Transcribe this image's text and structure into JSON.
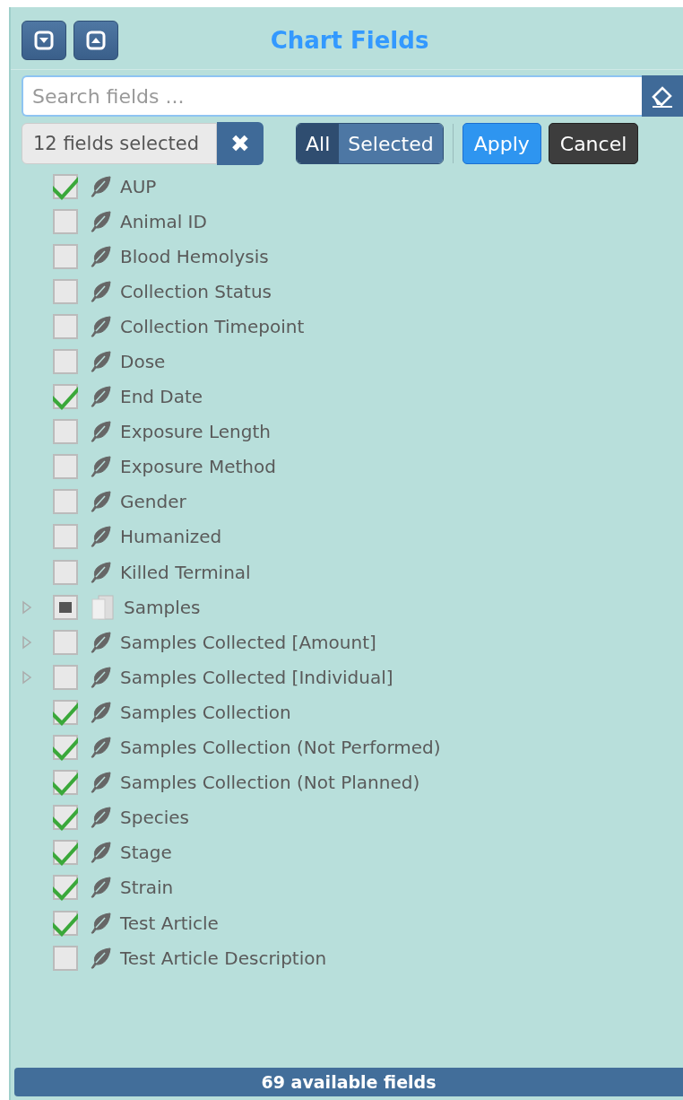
{
  "header": {
    "title": "Chart Fields"
  },
  "search": {
    "placeholder": "Search fields ..."
  },
  "selection": {
    "summary": "12 fields selected",
    "clear": "✖"
  },
  "filter_toggle": [
    {
      "label": "All",
      "selected": true
    },
    {
      "label": "Selected",
      "selected": false
    }
  ],
  "buttons": [
    {
      "label": "Apply",
      "kind": "primary"
    },
    {
      "label": "Cancel",
      "kind": "dark"
    }
  ],
  "fields": [
    {
      "label": "AUP",
      "kind": "field",
      "checked": true,
      "partial": false,
      "expandable": false
    },
    {
      "label": "Animal ID",
      "kind": "field",
      "checked": false,
      "partial": false,
      "expandable": false
    },
    {
      "label": "Blood Hemolysis",
      "kind": "field",
      "checked": false,
      "partial": false,
      "expandable": false
    },
    {
      "label": "Collection Status",
      "kind": "field",
      "checked": false,
      "partial": false,
      "expandable": false
    },
    {
      "label": "Collection Timepoint",
      "kind": "field",
      "checked": false,
      "partial": false,
      "expandable": false
    },
    {
      "label": "Dose",
      "kind": "field",
      "checked": false,
      "partial": false,
      "expandable": false
    },
    {
      "label": "End Date",
      "kind": "field",
      "checked": true,
      "partial": false,
      "expandable": false
    },
    {
      "label": "Exposure Length",
      "kind": "field",
      "checked": false,
      "partial": false,
      "expandable": false
    },
    {
      "label": "Exposure Method",
      "kind": "field",
      "checked": false,
      "partial": false,
      "expandable": false
    },
    {
      "label": "Gender",
      "kind": "field",
      "checked": false,
      "partial": false,
      "expandable": false
    },
    {
      "label": "Humanized",
      "kind": "field",
      "checked": false,
      "partial": false,
      "expandable": false
    },
    {
      "label": "Killed Terminal",
      "kind": "field",
      "checked": false,
      "partial": false,
      "expandable": false
    },
    {
      "label": "Samples",
      "kind": "folder",
      "checked": false,
      "partial": true,
      "expandable": true
    },
    {
      "label": "Samples Collected [Amount]",
      "kind": "field",
      "checked": false,
      "partial": false,
      "expandable": true
    },
    {
      "label": "Samples Collected [Individual]",
      "kind": "field",
      "checked": false,
      "partial": false,
      "expandable": true
    },
    {
      "label": "Samples Collection",
      "kind": "field",
      "checked": true,
      "partial": false,
      "expandable": false
    },
    {
      "label": "Samples Collection (Not Performed)",
      "kind": "field",
      "checked": true,
      "partial": false,
      "expandable": false
    },
    {
      "label": "Samples Collection (Not Planned)",
      "kind": "field",
      "checked": true,
      "partial": false,
      "expandable": false
    },
    {
      "label": "Species",
      "kind": "field",
      "checked": true,
      "partial": false,
      "expandable": false
    },
    {
      "label": "Stage",
      "kind": "field",
      "checked": true,
      "partial": false,
      "expandable": false
    },
    {
      "label": "Strain",
      "kind": "field",
      "checked": true,
      "partial": false,
      "expandable": false
    },
    {
      "label": "Test Article",
      "kind": "field",
      "checked": true,
      "partial": false,
      "expandable": false
    },
    {
      "label": "Test Article Description",
      "kind": "field",
      "checked": false,
      "partial": false,
      "expandable": false
    }
  ],
  "status_bar": {
    "text": "69 available fields"
  }
}
